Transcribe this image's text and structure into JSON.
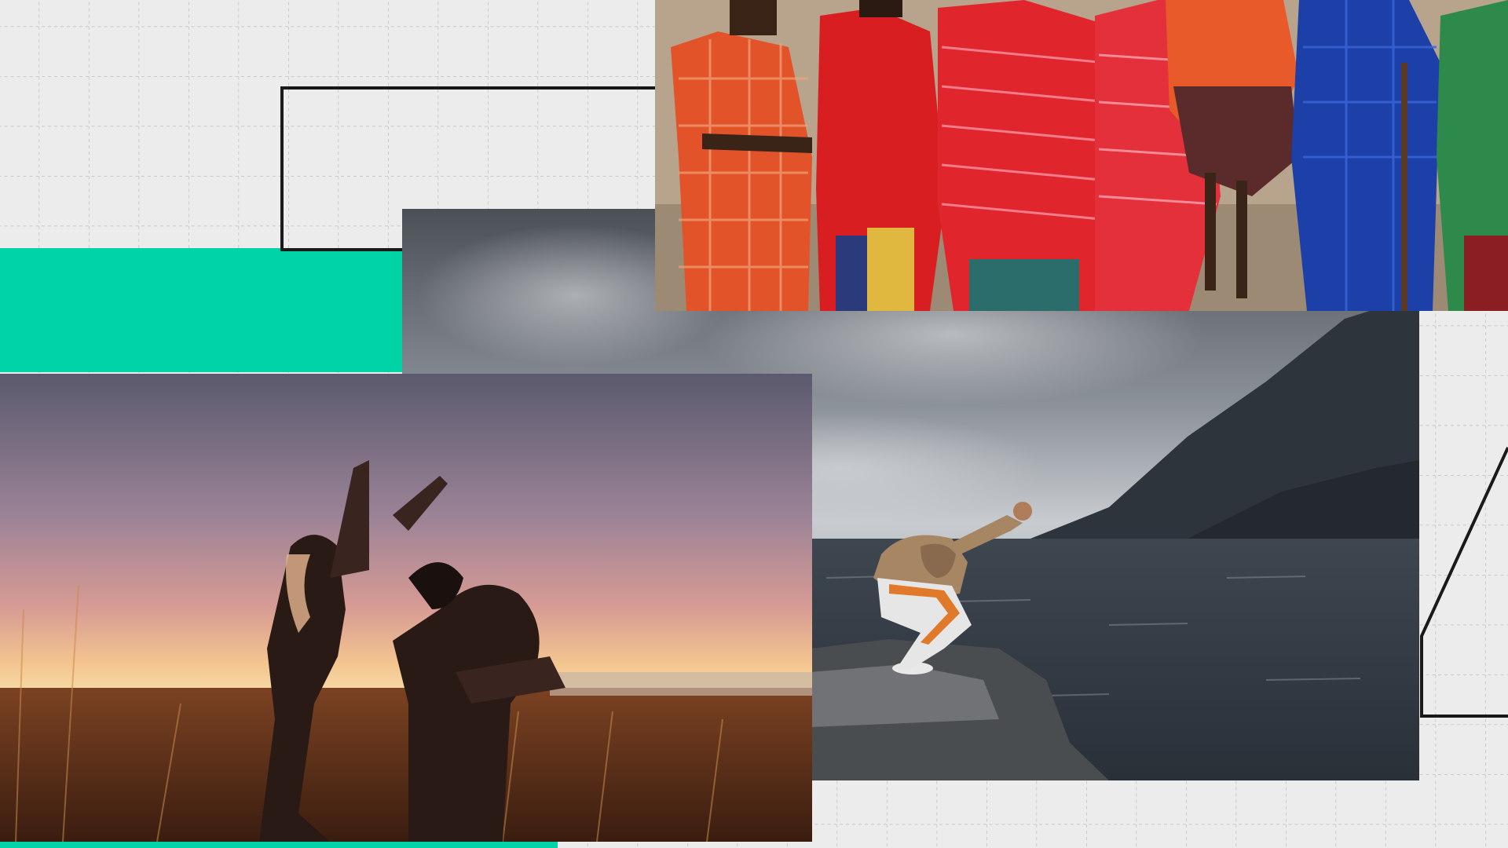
{
  "scene": {
    "background_color": "#ececec",
    "grid_color": "#bdbdbd",
    "accent_color": "#00d3a6",
    "outline_color": "#1a1a1a"
  },
  "photos": [
    {
      "subject": "maasai-people-red-shukas"
    },
    {
      "subject": "stormy-sky-lake-crouching-person"
    },
    {
      "subject": "women-dancing-sunset-grass-field"
    }
  ]
}
